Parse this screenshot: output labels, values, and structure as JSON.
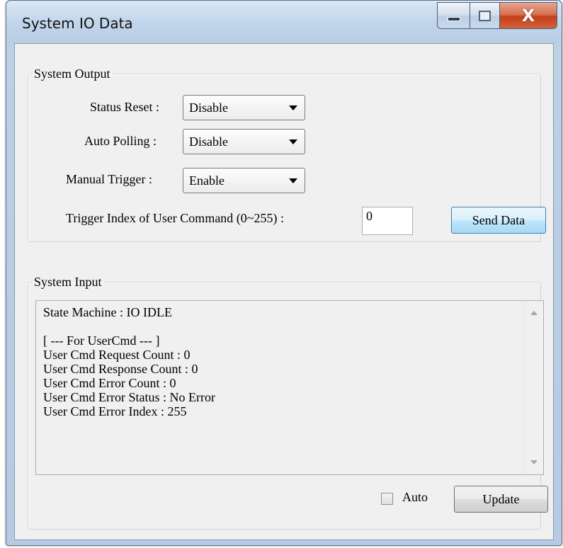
{
  "window": {
    "title": "System IO Data",
    "controls": {
      "minimize": "minimize",
      "maximize": "maximize",
      "close": "X"
    }
  },
  "system_output": {
    "legend": "System Output",
    "status_reset": {
      "label": "Status Reset :",
      "value": "Disable"
    },
    "auto_polling": {
      "label": "Auto Polling :",
      "value": "Disable"
    },
    "manual_trigger": {
      "label": "Manual Trigger :",
      "value": "Enable"
    },
    "trigger_index": {
      "label": "Trigger Index of User Command (0~255) :",
      "value": "0"
    },
    "send_button": "Send Data"
  },
  "system_input": {
    "legend": "System Input",
    "text": "State Machine : IO IDLE\n\n[ --- For UserCmd --- ]\nUser Cmd Request Count : 0\nUser Cmd Response Count : 0\nUser Cmd Error Count : 0\nUser Cmd Error Status : No Error\nUser Cmd Error Index : 255",
    "auto_label": "Auto",
    "auto_checked": false,
    "update_button": "Update"
  },
  "icons": [
    "minimize-icon",
    "maximize-icon",
    "close-icon",
    "dropdown-arrow-icon",
    "scroll-up-icon",
    "scroll-down-icon"
  ]
}
